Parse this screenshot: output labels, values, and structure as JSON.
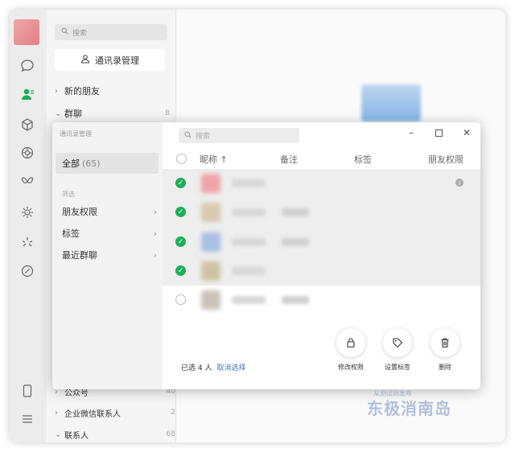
{
  "sidebar": {
    "icons": [
      "chat-icon",
      "contacts-icon",
      "box-icon",
      "aperture-icon",
      "butterfly-icon",
      "gear-icon",
      "sparkle-icon",
      "link-icon",
      "phone-icon",
      "menu-icon"
    ]
  },
  "contacts": {
    "search_placeholder": "搜索",
    "manage_button": "通讯录管理",
    "rows": [
      {
        "label": "新的朋友",
        "count": ""
      },
      {
        "label": "群聊",
        "count": "8"
      }
    ],
    "bottom_rows": [
      {
        "label": "公众号",
        "count": "40"
      },
      {
        "label": "企业微信联系人",
        "count": "2"
      },
      {
        "label": "联系人",
        "count": "68"
      }
    ],
    "watermark": "东极消南岛",
    "watermark_sub": "从测试到发布"
  },
  "modal": {
    "title": "通讯录管理",
    "all_label": "全部",
    "all_count": "(65)",
    "filter_section": "筛选",
    "filters": [
      "朋友权限",
      "标签",
      "最近群聊"
    ],
    "search_placeholder": "搜索",
    "columns": {
      "nickname": "昵称 ↑",
      "remark": "备注",
      "tag": "标签",
      "permission": "朋友权限"
    },
    "rows": [
      {
        "checked": true,
        "avatar_color": "#f0a4a8"
      },
      {
        "checked": true,
        "avatar_color": "#d9c9b0"
      },
      {
        "checked": true,
        "avatar_color": "#a9bfe4"
      },
      {
        "checked": true,
        "avatar_color": "#cfc2a4"
      },
      {
        "checked": false,
        "avatar_color": "#c9c2b8"
      }
    ],
    "selected_text": "已选 4 人",
    "cancel_select": "取消选择",
    "actions": [
      {
        "label": "修改权限",
        "icon": "lock-icon"
      },
      {
        "label": "设置标签",
        "icon": "tag-icon"
      },
      {
        "label": "删除",
        "icon": "trash-icon"
      }
    ]
  },
  "colors": {
    "check_green": "#1fae5b",
    "link_blue": "#4a78b4"
  }
}
